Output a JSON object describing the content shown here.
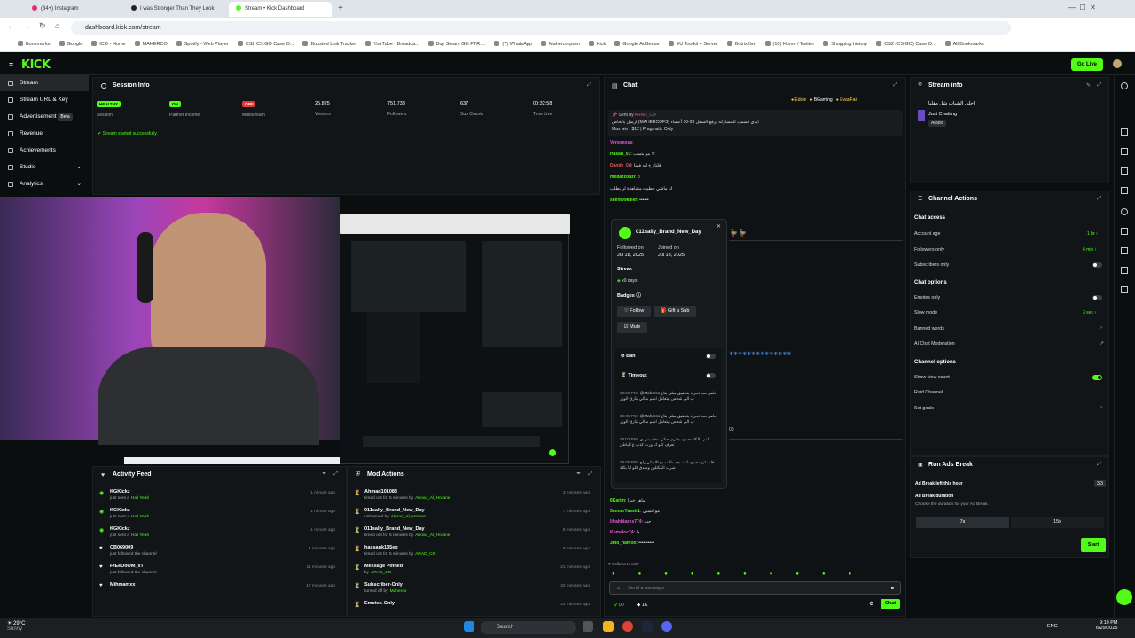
{
  "browser": {
    "tabs": [
      {
        "label": "(34+) Instagram",
        "color": "#e1306c"
      },
      {
        "label": "I was Stronger Than They Look",
        "color": "#222222"
      },
      {
        "label": "Stream • Kick Dashboard",
        "color": "#53fc18"
      }
    ],
    "url": "dashboard.kick.com/stream",
    "bookmarks": [
      "Bookmarks",
      "Google",
      "ICO - Home",
      "MAHERCO",
      "Spotify - Web Player",
      "CS2 CS:GO Case O...",
      "Boosted Link Tracker",
      "YouTube - Broadca...",
      "Buy Steam Gift PTR ...",
      "(7) WhatsApp",
      "Mahercorpssn",
      "Kick",
      "Google AdSense",
      "EU Toolkit + Server",
      "Botrix.live",
      "(10) Home / Twitter",
      "Shopping history",
      "CS2 (CS:GO) Case O...",
      "All Bookmarks"
    ]
  },
  "app": {
    "logo": "KICK",
    "go_live": "Go Live"
  },
  "sidebar": {
    "items": [
      {
        "label": "Stream"
      },
      {
        "label": "Stream URL & Key"
      },
      {
        "label": "Advertisement",
        "badge": "Beta"
      },
      {
        "label": "Revenue"
      },
      {
        "label": "Achievements"
      },
      {
        "label": "Studio"
      },
      {
        "label": "Analytics"
      }
    ]
  },
  "session": {
    "title": "Session Info",
    "stats": [
      {
        "pill": "HEALTHY",
        "pill_color": "#53fc18",
        "label": "Session"
      },
      {
        "pill": "ON",
        "pill_color": "#53fc18",
        "label": "Partner Income"
      },
      {
        "pill": "OFF",
        "pill_color": "#e53935",
        "label": "Multistream"
      },
      {
        "value": "25,825",
        "label": "Viewers"
      },
      {
        "value": "751,733",
        "label": "Followers"
      },
      {
        "value": "637",
        "label": "Sub Counts"
      },
      {
        "value": "00:32:58",
        "label": "Time Live"
      }
    ],
    "status": "Stream started successfully."
  },
  "activity": {
    "title": "Activity Feed",
    "items": [
      {
        "name": "KGKickz",
        "line": "just sent a",
        "hl": "Hail Yeah",
        "time": "1 minute ago",
        "count": "1"
      },
      {
        "name": "KGKickz",
        "line": "just sent a",
        "hl": "Hail Yeah",
        "time": "1 minute ago",
        "count": "1"
      },
      {
        "name": "KGKickz",
        "line": "just sent a",
        "hl": "Hail Yeah",
        "time": "1 minute ago",
        "count": "1"
      },
      {
        "name": "CB069009",
        "line": "just followed the channel",
        "hl": "",
        "time": "4 minutes ago",
        "count": ""
      },
      {
        "name": "FrEeDoOM_xT",
        "line": "just followed the channel",
        "hl": "",
        "time": "11 minutes ago",
        "count": ""
      },
      {
        "name": "Mihmamxx",
        "line": "",
        "hl": "",
        "time": "17 minutes ago",
        "count": ""
      }
    ]
  },
  "mod": {
    "title": "Mod Actions",
    "items": [
      {
        "name": "Ahmad101083",
        "line": "timed out for 5 minutes by",
        "by": "Abood_Al_Horane",
        "time": "3 minutes ago"
      },
      {
        "name": "011sally_Brand_New_Day",
        "line": "unbanned by",
        "by": "Abood_Al_Horane",
        "time": "7 minutes ago"
      },
      {
        "name": "011sally_Brand_New_Day",
        "line": "timed out for 5 minutes by",
        "by": "Abood_Al_Horane",
        "time": "8 minutes ago"
      },
      {
        "name": "hassank135eq",
        "line": "timed out for 5 minutes by",
        "by": "ARAD_CO",
        "time": "9 minutes ago"
      },
      {
        "name": "Message Pinned",
        "line": "by",
        "by": "ARAD_CO",
        "time": "21 minutes ago"
      },
      {
        "name": "Subscriber-Only",
        "line": "turned off by",
        "by": "Maherco",
        "time": "32 minutes ago"
      },
      {
        "name": "Emotes-Only",
        "line": "",
        "by": "",
        "time": "32 minutes ago"
      }
    ]
  },
  "chat": {
    "title": "Chat",
    "top_users": [
      "Eddie",
      "BGaming",
      "EvanFair"
    ],
    "pinned_by": "Sent by",
    "pinned_user": "ARAD_CO",
    "pinned_text": "ارسل بالخاص (MAHERCOFS) ايدي قسمك للمشاركة برفع الشغل 28-30 أعضاء",
    "pinned_text2": "Max win : $12 | Pragmatic Only",
    "lines": [
      {
        "name": "Venomous",
        "text": "",
        "color": "#e05bd7"
      },
      {
        "name": "Hasan_01",
        "text": "مو بتسب !!!",
        "color": "#53fc18"
      },
      {
        "name": "Dande_0d",
        "text": "قلنا رح ايه فيما",
        "color": "#e05b5b"
      },
      {
        "name": "medazzouzi",
        "text": "p",
        "color": "#53fc18"
      },
      {
        "name": "",
        "text": "انا ماشي حطيت مشاهدة لر بطلب",
        "color": "#53fc18"
      },
      {
        "name": "silent99killer",
        "text": "••••••",
        "color": "#53fc18"
      }
    ],
    "lines_bottom": [
      {
        "name": "6Karim",
        "text": "ماهر خيرا",
        "color": "#53fc18"
      },
      {
        "name": "3mmarYassir1",
        "text": "مو كسبي",
        "color": "#53fc18"
      },
      {
        "name": "lilrahblazes774",
        "text": "حب",
        "color": "#e05bd7"
      },
      {
        "name": "Komaloc74",
        "text": "ها",
        "color": "#e05bd7"
      },
      {
        "name": "3mo_hamoo",
        "text": "••••••••••",
        "color": "#53fc18"
      }
    ],
    "followers_only": "Followers only",
    "placeholder": "Send a message",
    "count": "1K",
    "chat_button": "Chat",
    "viewer_count": "00"
  },
  "profile": {
    "username": "011sally_Brand_New_Day",
    "followed_label": "Followed on",
    "followed": "Jul 18, 2025",
    "joined_label": "Joined on",
    "joined": "Jul 18, 2025",
    "streak_label": "Streak",
    "streak": "x0 days",
    "badges_label": "Badges",
    "follow": "Follow",
    "gift": "Gift a Sub",
    "mute": "Mute",
    "ban": "Ban",
    "timeout": "Timeout",
    "messages": [
      {
        "time": "08:59 PM",
        "text": "@Maherco ماهر حب تحرك بتحقيق سلي بتاع ب الي شخص بيتعامل اسم سالي بتارق الوزر"
      },
      {
        "time": "09:05 PM",
        "text": "@Maherco ماهر حب تحرك بتحقيق سلي بتاع ب الي شخص بيتعامل اسم سالي بتارق الوزر"
      },
      {
        "time": "09:07 PM",
        "text": "انتم مالكا محمود بحترم احكي معاه بس ي تعرف كلو انا ورب كذب ع الباطن"
      },
      {
        "time": "09:08 PM",
        "text": "قلب ابو محمود انت بعد مالتمسح الا بنلي راح ضرب المكثلين وصدق كلو انا بكلة"
      }
    ]
  },
  "stream_info": {
    "title": "Stream info",
    "stream_title": "احلى الشباب شل مقلبا",
    "category": "Just Chatting",
    "language": "Arabic"
  },
  "channel_actions": {
    "title": "Channel Actions",
    "chat_access": "Chat access",
    "account_age": "Account age",
    "account_age_val": "1 hr",
    "followers_only": "Followers only",
    "followers_only_val": "6 min",
    "subscribers_only": "Subscribers only",
    "chat_options": "Chat options",
    "emotes_only": "Emotes only",
    "slow_mode": "Slow mode",
    "slow_mode_val": "3 sec",
    "banned_words": "Banned words",
    "ai_moderation": "AI Chat Moderation",
    "channel_options": "Channel options",
    "show_view_count": "Show view count",
    "raid_channel": "Raid Channel",
    "set_goals": "Set goals"
  },
  "ads": {
    "title": "Run Ads Break",
    "left_label": "Ad Break left this hour",
    "left_val": "3/3",
    "duration_label": "Ad Break duration",
    "duration_hint": "Choose the duration for your Ad Break.",
    "opt1": "7s",
    "opt2": "15s",
    "start": "Start"
  },
  "taskbar": {
    "weather": "29°C",
    "weather_sub": "Sunny",
    "search": "Search",
    "lang": "ENG",
    "time": "9:10 PM",
    "date": "6/29/2025"
  }
}
